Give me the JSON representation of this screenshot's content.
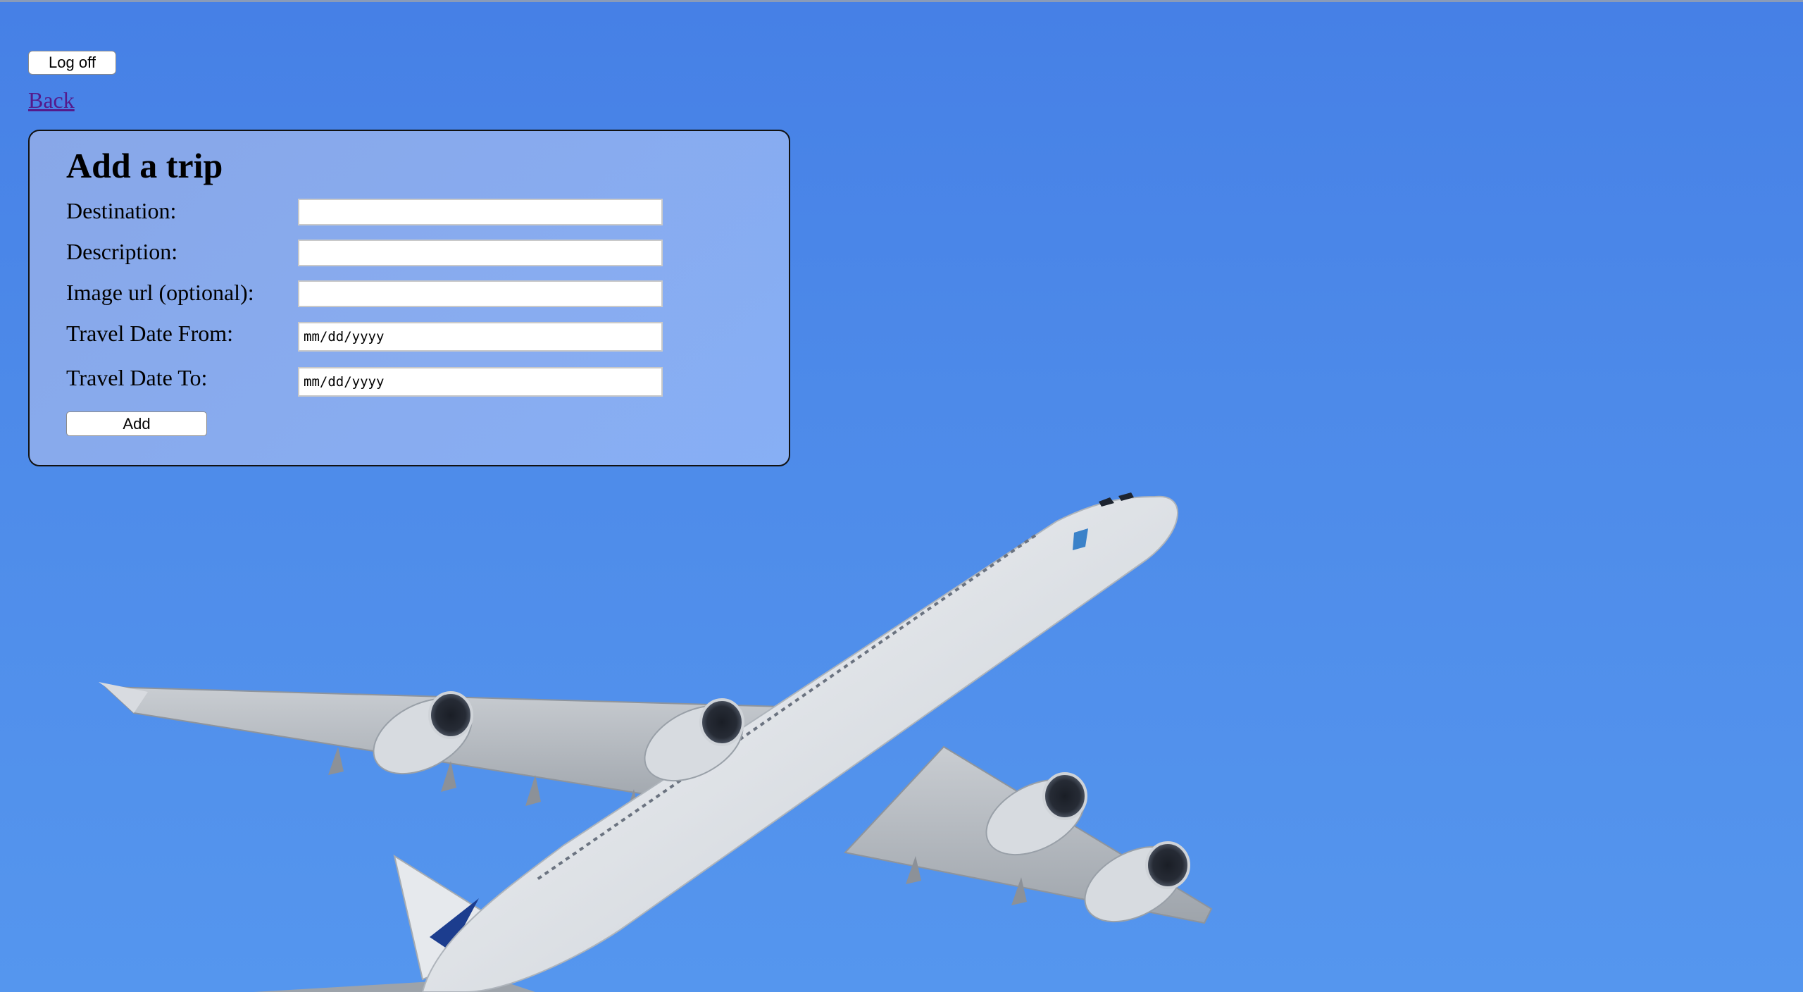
{
  "header": {
    "logoff_label": "Log off",
    "back_label": "Back"
  },
  "form": {
    "title": "Add a trip",
    "fields": [
      {
        "label": "Destination:",
        "value": ""
      },
      {
        "label": "Description:",
        "value": ""
      },
      {
        "label": "Image url (optional):",
        "value": ""
      },
      {
        "label": "Travel Date From:",
        "value": "mm/dd/yyyy"
      },
      {
        "label": "Travel Date To:",
        "value": "mm/dd/yyyy"
      }
    ],
    "submit_label": "Add"
  },
  "colors": {
    "sky": "#4d8ae9",
    "panel": "#8cb2f6",
    "link_visited": "#551a8b"
  },
  "background_image": "airplane-in-sky"
}
